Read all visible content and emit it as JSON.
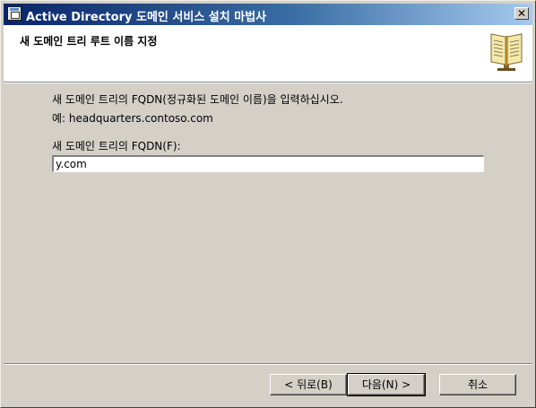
{
  "window": {
    "title": "Active Directory 도메인 서비스 설치 마법사",
    "close_glyph": "✕"
  },
  "header": {
    "title": "새 도메인 트리 루트 이름 지정",
    "icon": "book-icon"
  },
  "main": {
    "description_line1": "새 도메인 트리의 FQDN(정규화된 도메인 이름)을 입력하십시오.",
    "description_line2": "예: headquarters.contoso.com",
    "field_label": "새 도메인 트리의 FQDN(F):",
    "field_value": "y.com"
  },
  "buttons": {
    "back": "< 뒤로(B)",
    "next": "다음(N) >",
    "cancel": "취소"
  },
  "colors": {
    "titlebar_start": "#0a246a",
    "titlebar_end": "#a6caf0",
    "dialog_face": "#d4d0c8"
  }
}
